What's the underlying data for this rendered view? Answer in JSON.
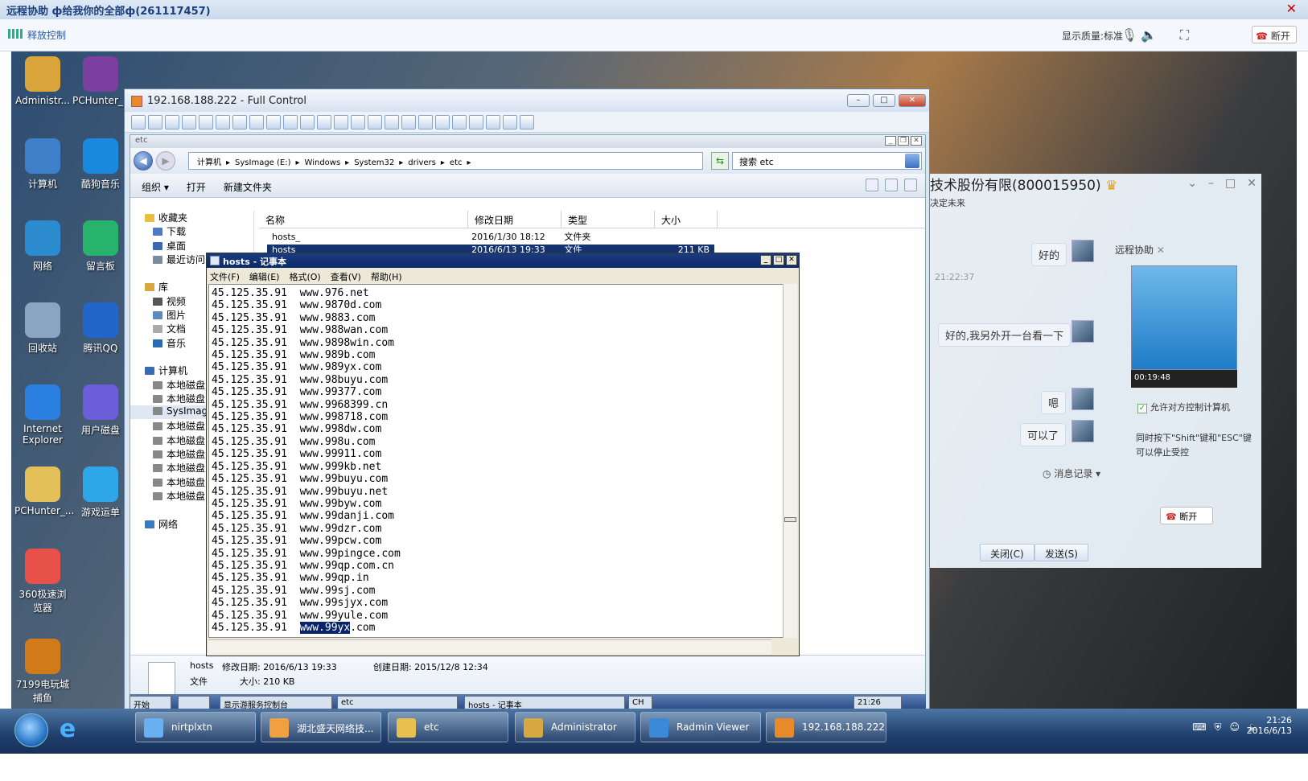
{
  "remote": {
    "title": "远程协助 ф给我你的全部ф(261117457)",
    "release_control": "释放控制",
    "quality": "显示质量:标准",
    "disconnect": "断开"
  },
  "desktop_icons": [
    {
      "label": "Administr...",
      "icon": "folder-user-icon",
      "color": "#d9a43a"
    },
    {
      "label": "PCHunter_...",
      "icon": "winrar-icon",
      "color": "#7a3fa0"
    },
    {
      "label": "计算机",
      "icon": "computer-icon",
      "color": "#3d7fc8"
    },
    {
      "label": "酷狗音乐",
      "icon": "kugou-icon",
      "color": "#1a8ae0"
    },
    {
      "label": "网络",
      "icon": "network-icon",
      "color": "#2d8bd0"
    },
    {
      "label": "留言板",
      "icon": "notes-icon",
      "color": "#27b36b"
    },
    {
      "label": "回收站",
      "icon": "recycle-bin-icon",
      "color": "#8aa4c2"
    },
    {
      "label": "腾讯QQ",
      "icon": "qq-icon",
      "color": "#2266cc"
    },
    {
      "label": "Internet Explorer",
      "icon": "ie-icon",
      "color": "#2a7fe0"
    },
    {
      "label": "用户磁盘",
      "icon": "user-disk-icon",
      "color": "#6a5fd8"
    },
    {
      "label": "PCHunter_...",
      "icon": "folder-icon",
      "color": "#e4c05a"
    },
    {
      "label": "游戏运单",
      "icon": "game-icon",
      "color": "#2ea7e8"
    },
    {
      "label": "360极速浏览器",
      "icon": "browser-360-icon",
      "color": "#e8504a"
    },
    {
      "label": "7199电玩城捕鱼",
      "icon": "fishing-game-icon",
      "color": "#d07a1a"
    }
  ],
  "fc": {
    "title": "192.168.188.222 - Full Control",
    "explorer_title": "etc",
    "path": [
      "计算机",
      "▸",
      "SysImage (E:)",
      "▸",
      "Windows",
      "▸",
      "System32",
      "▸",
      "drivers",
      "▸",
      "etc",
      "▸"
    ],
    "search": "搜索 etc",
    "commands": [
      "组织 ▾",
      "打开",
      "新建文件夹"
    ],
    "tree": [
      {
        "label": "收藏夹",
        "indent": 0,
        "color": "#e8c040"
      },
      {
        "label": "下载",
        "indent": 1,
        "color": "#4a7ac8"
      },
      {
        "label": "桌面",
        "indent": 1,
        "color": "#3a6ab0"
      },
      {
        "label": "最近访问",
        "indent": 1,
        "color": "#7a8aa0"
      },
      {
        "label": "",
        "indent": 0,
        "color": ""
      },
      {
        "label": "库",
        "indent": 0,
        "color": "#d8a840"
      },
      {
        "label": "视频",
        "indent": 1,
        "color": "#555"
      },
      {
        "label": "图片",
        "indent": 1,
        "color": "#5a8ac0"
      },
      {
        "label": "文档",
        "indent": 1,
        "color": "#aaa"
      },
      {
        "label": "音乐",
        "indent": 1,
        "color": "#2a6ab0"
      },
      {
        "label": "",
        "indent": 0,
        "color": ""
      },
      {
        "label": "计算机",
        "indent": 0,
        "color": "#3a6ab0"
      },
      {
        "label": "本地磁盘",
        "indent": 1,
        "color": "#888"
      },
      {
        "label": "本地磁盘",
        "indent": 1,
        "color": "#888"
      },
      {
        "label": "SysImage",
        "indent": 1,
        "color": "#888",
        "sel": true
      },
      {
        "label": "本地磁盘",
        "indent": 1,
        "color": "#888"
      },
      {
        "label": "本地磁盘",
        "indent": 1,
        "color": "#888"
      },
      {
        "label": "本地磁盘",
        "indent": 1,
        "color": "#888"
      },
      {
        "label": "本地磁盘",
        "indent": 1,
        "color": "#888"
      },
      {
        "label": "本地磁盘",
        "indent": 1,
        "color": "#888"
      },
      {
        "label": "本地磁盘",
        "indent": 1,
        "color": "#888"
      },
      {
        "label": "",
        "indent": 0,
        "color": ""
      },
      {
        "label": "网络",
        "indent": 0,
        "color": "#3a7ac0"
      }
    ],
    "columns": [
      "名称",
      "修改日期",
      "类型",
      "大小"
    ],
    "files": [
      {
        "name": "hosts_",
        "date": "2016/1/30 18:12",
        "type": "文件夹",
        "size": ""
      },
      {
        "name": "hosts",
        "date": "2016/6/13 19:33",
        "type": "文件",
        "size": "211 KB"
      }
    ],
    "details": {
      "name": "hosts",
      "modified": "修改日期: 2016/6/13 19:33",
      "created": "创建日期: 2015/12/8 12:34",
      "type": "文件",
      "size": "大小: 210 KB"
    },
    "inner_taskbar": [
      "开始",
      "",
      "显示游服务控制台",
      "etc",
      "hosts - 记事本",
      "CH",
      "21:26"
    ]
  },
  "notepad": {
    "title": "hosts - 记事本",
    "menu": [
      "文件(F)",
      "编辑(E)",
      "格式(O)",
      "查看(V)",
      "帮助(H)"
    ],
    "lines": [
      "45.125.35.91  www.976.net",
      "45.125.35.91  www.9870d.com",
      "45.125.35.91  www.9883.com",
      "45.125.35.91  www.988wan.com",
      "45.125.35.91  www.9898win.com",
      "45.125.35.91  www.989b.com",
      "45.125.35.91  www.989yx.com",
      "45.125.35.91  www.98buyu.com",
      "45.125.35.91  www.99377.com",
      "45.125.35.91  www.9968399.cn",
      "45.125.35.91  www.998718.com",
      "45.125.35.91  www.998dw.com",
      "45.125.35.91  www.998u.com",
      "45.125.35.91  www.99911.com",
      "45.125.35.91  www.999kb.net",
      "45.125.35.91  www.99buyu.com",
      "45.125.35.91  www.99buyu.net",
      "45.125.35.91  www.99byw.com",
      "45.125.35.91  www.99danji.com",
      "45.125.35.91  www.99dzr.com",
      "45.125.35.91  www.99pcw.com",
      "45.125.35.91  www.99pingce.com",
      "45.125.35.91  www.99qp.com.cn",
      "45.125.35.91  www.99qp.in",
      "45.125.35.91  www.99sj.com",
      "45.125.35.91  www.99sjyx.com",
      "45.125.35.91  www.99yule.com"
    ],
    "last_prefix": "45.125.35.91  ",
    "last_selected": "www.99yx",
    "last_suffix": ".com"
  },
  "chat": {
    "title": "技术股份有限(800015950)",
    "subtitle": "决定未来",
    "time": "21:22:37",
    "messages": [
      "好的",
      "好的,我另外开一台看一下",
      "嗯",
      "可以了"
    ],
    "history": "消息记录 ▾",
    "close": "关闭(C)",
    "send": "发送(S)"
  },
  "assist_panel": {
    "tab": "远程协助",
    "timer": "00:19:48",
    "allow": "允许对方控制计算机",
    "hint": "同时按下\"Shift\"键和\"ESC\"键可以停止受控",
    "disconnect": "断开"
  },
  "taskbar": {
    "buttons": [
      {
        "label": "nirtplxtn",
        "color": "#6ab0f0"
      },
      {
        "label": "湖北盛天网络技...",
        "color": "#f0a040"
      },
      {
        "label": "etc",
        "color": "#e8c050"
      },
      {
        "label": "Administrator",
        "color": "#d8a840"
      },
      {
        "label": "Radmin Viewer",
        "color": "#3a8ad8"
      },
      {
        "label": "192.168.188.222...",
        "color": "#e88a2c"
      }
    ],
    "time": "21:26",
    "date": "2016/6/13"
  }
}
